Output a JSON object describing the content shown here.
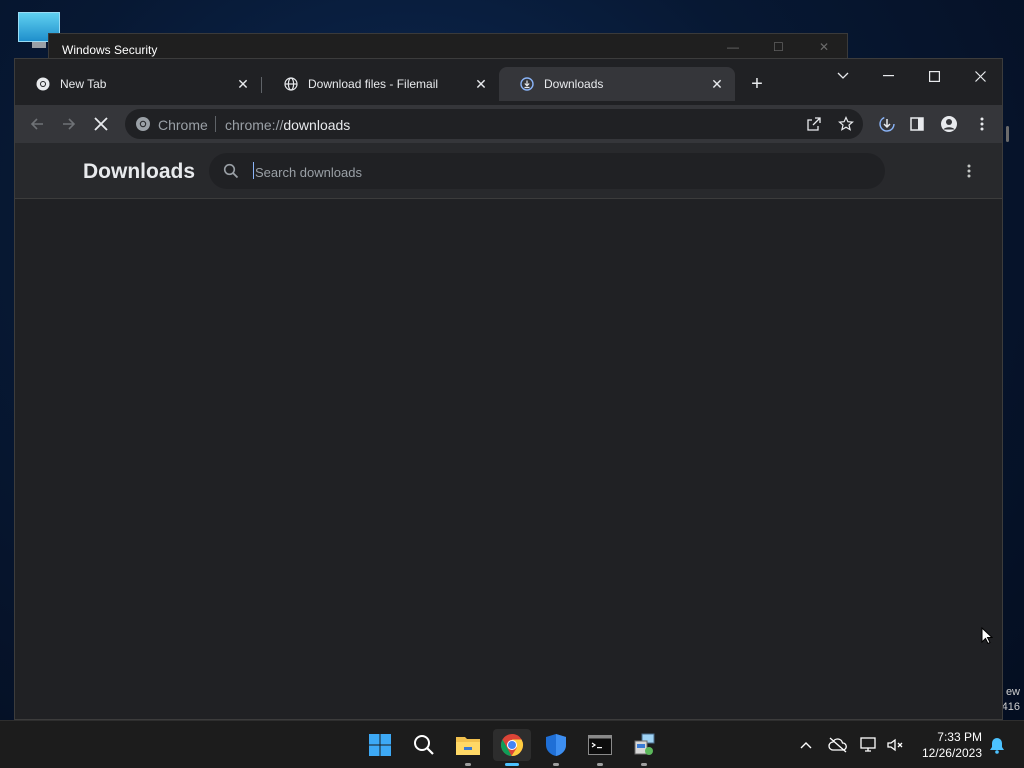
{
  "background_window": {
    "title": "Windows Security",
    "edge_text_1": "ew",
    "edge_text_2": "416"
  },
  "browser": {
    "tabs": [
      {
        "label": "New Tab",
        "icon": "chrome-icon",
        "active": false
      },
      {
        "label": "Download files - Filemail",
        "icon": "globe-icon",
        "active": false
      },
      {
        "label": "Downloads",
        "icon": "download-icon",
        "active": true
      }
    ],
    "omnibox": {
      "site_label": "Chrome",
      "url_scheme": "chrome://",
      "url_host": "downloads"
    }
  },
  "page": {
    "title": "Downloads",
    "search_placeholder": "Search downloads"
  },
  "taskbar": {
    "apps": [
      "windows-start-icon",
      "search-icon",
      "file-explorer-icon",
      "chrome-icon",
      "windows-security-icon",
      "terminal-icon",
      "network-tool-icon"
    ],
    "time": "7:33 PM",
    "date": "12/26/2023"
  },
  "colors": {
    "accent": "#8ab4f8",
    "taskbar_indicator": "#4cc2ff",
    "page_bg": "#202124",
    "toolbar_bg": "#35363a"
  }
}
